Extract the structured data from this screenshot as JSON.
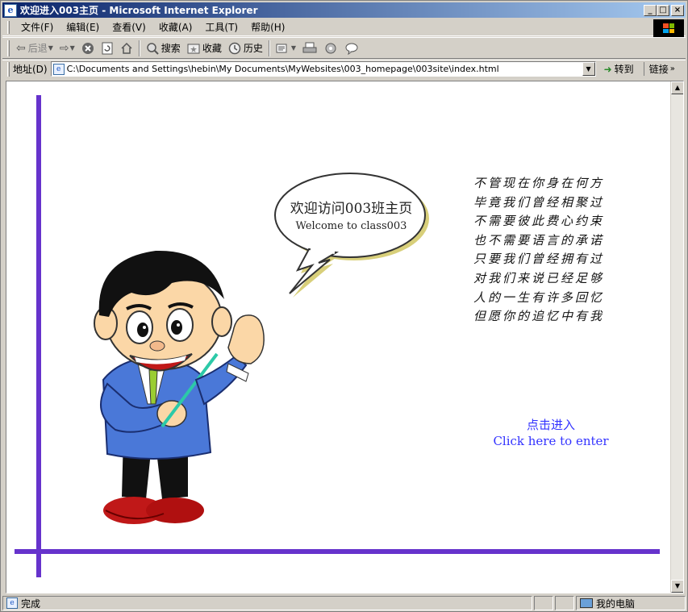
{
  "window": {
    "title": "欢迎进入003主页 - Microsoft Internet Explorer",
    "min_label": "_",
    "max_label": "□",
    "close_label": "×"
  },
  "menubar": {
    "items": [
      "文件(F)",
      "编辑(E)",
      "查看(V)",
      "收藏(A)",
      "工具(T)",
      "帮助(H)"
    ]
  },
  "toolbar": {
    "back_label": "后退",
    "search_label": "搜索",
    "favorites_label": "收藏",
    "history_label": "历史"
  },
  "address": {
    "label": "地址(D)",
    "url": "C:\\Documents and Settings\\hebin\\My Documents\\MyWebsites\\003_homepage\\003site\\index.html",
    "go_label": "转到",
    "links_label": "链接"
  },
  "page": {
    "bubble_cn": "欢迎访问003班主页",
    "bubble_en": "Welcome to class003",
    "poem": [
      "不管现在你身在何方",
      "毕竟我们曾经相聚过",
      "不需要彼此费心约束",
      "也不需要语言的承诺",
      "只要我们曾经拥有过",
      "对我们来说已经足够",
      "人的一生有许多回忆",
      "但愿你的追忆中有我"
    ],
    "enter_cn": "点击进入",
    "enter_en": "Click here to enter",
    "accent_color": "#6633cc",
    "link_color": "#3333ff"
  },
  "status": {
    "text": "完成",
    "zone": "我的电脑"
  }
}
